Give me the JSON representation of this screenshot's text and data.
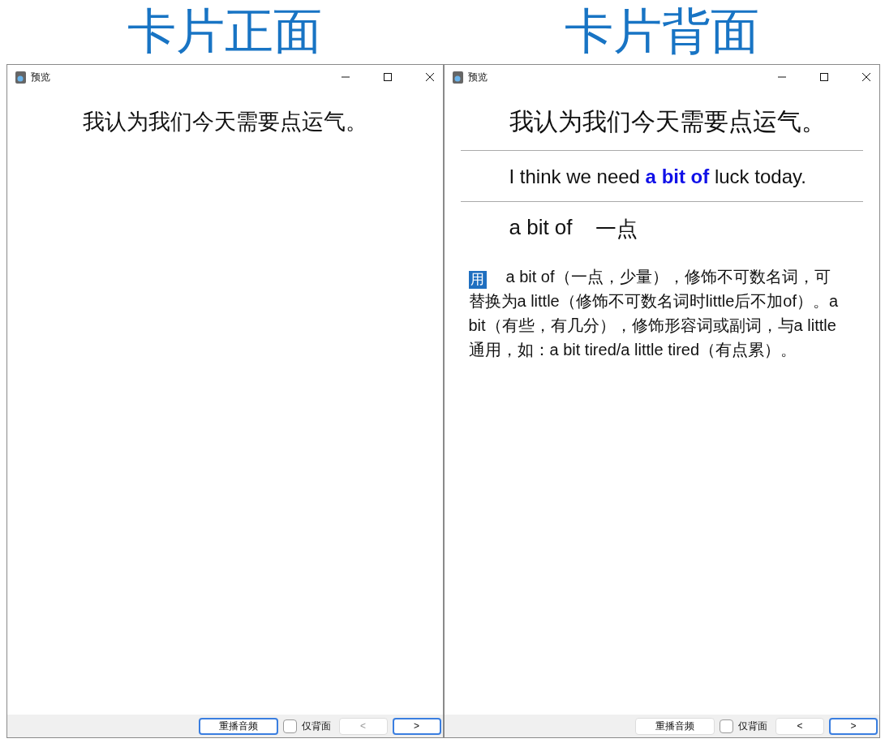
{
  "panels": [
    {
      "heading": "卡片正面",
      "window": {
        "title": "预览",
        "content": [
          {
            "kind": "prompt",
            "text": "我认为我们今天需要点运气。"
          }
        ]
      },
      "toolbar": {
        "replay": {
          "label": "重播音频",
          "focused": true
        },
        "back_only": {
          "label": "仅背面",
          "checked": false
        },
        "prev": {
          "label": "<",
          "disabled": true,
          "focused": false
        },
        "next": {
          "label": ">",
          "disabled": false,
          "focused": true
        }
      }
    },
    {
      "heading": "卡片背面",
      "window": {
        "title": "预览",
        "content": [
          {
            "kind": "sentence",
            "text": "我认为我们今天需要点运气。"
          },
          {
            "kind": "translation",
            "text": "I think we need **a bit of** luck today."
          },
          {
            "kind": "phrase",
            "term": "a bit of",
            "meaning": "一点"
          },
          {
            "kind": "note",
            "badge": "用",
            "text": "a bit of（一点，少量），修饰不可数名词，可替换为a little（修饰不可数名词时little后不加of）。a bit（有些，有几分），修饰形容词或副词，与a little通用，如：a bit tired/a little tired（有点累）。"
          }
        ]
      },
      "toolbar": {
        "replay": {
          "label": "重播音频",
          "focused": false
        },
        "back_only": {
          "label": "仅背面",
          "checked": false
        },
        "prev": {
          "label": "<",
          "disabled": false,
          "focused": false
        },
        "next": {
          "label": ">",
          "disabled": false,
          "focused": true
        }
      }
    }
  ]
}
